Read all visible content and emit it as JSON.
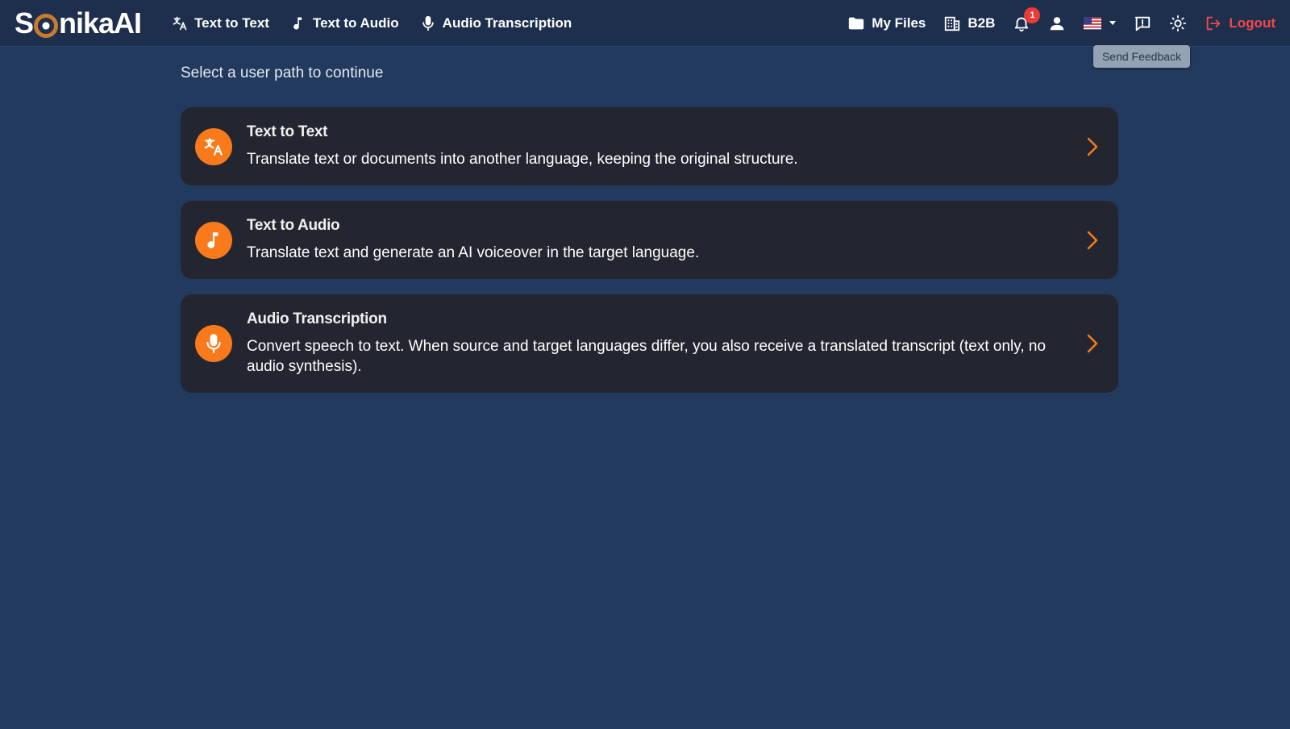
{
  "app": {
    "logo_prefix": "S",
    "logo_suffix": "nikaAI"
  },
  "nav": {
    "left": [
      {
        "label": "Text to Text",
        "icon": "translate-icon"
      },
      {
        "label": "Text to Audio",
        "icon": "music-note-icon"
      },
      {
        "label": "Audio Transcription",
        "icon": "microphone-icon"
      }
    ],
    "my_files": "My Files",
    "b2b": "B2B",
    "notification_count": "1",
    "logout": "Logout"
  },
  "tooltip": {
    "text": "Send Feedback"
  },
  "main": {
    "heading": "Select a user path to continue",
    "cards": [
      {
        "title": "Text to Text",
        "description": "Translate text or documents into another language, keeping the original structure.",
        "icon": "translate-icon"
      },
      {
        "title": "Text to Audio",
        "description": "Translate text and generate an AI voiceover in the target language.",
        "icon": "music-note-icon"
      },
      {
        "title": "Audio Transcription",
        "description": "Convert speech to text. When source and target languages differ, you also receive a translated transcript (text only, no audio synthesis).",
        "icon": "microphone-icon"
      }
    ]
  },
  "colors": {
    "background": "#223a5e",
    "navbar": "#1e2f4e",
    "card": "#232631",
    "accent": "#f97a1b",
    "logo_ring": "#c97a2b",
    "logout": "#f24848",
    "badge": "#ea3b3b"
  }
}
